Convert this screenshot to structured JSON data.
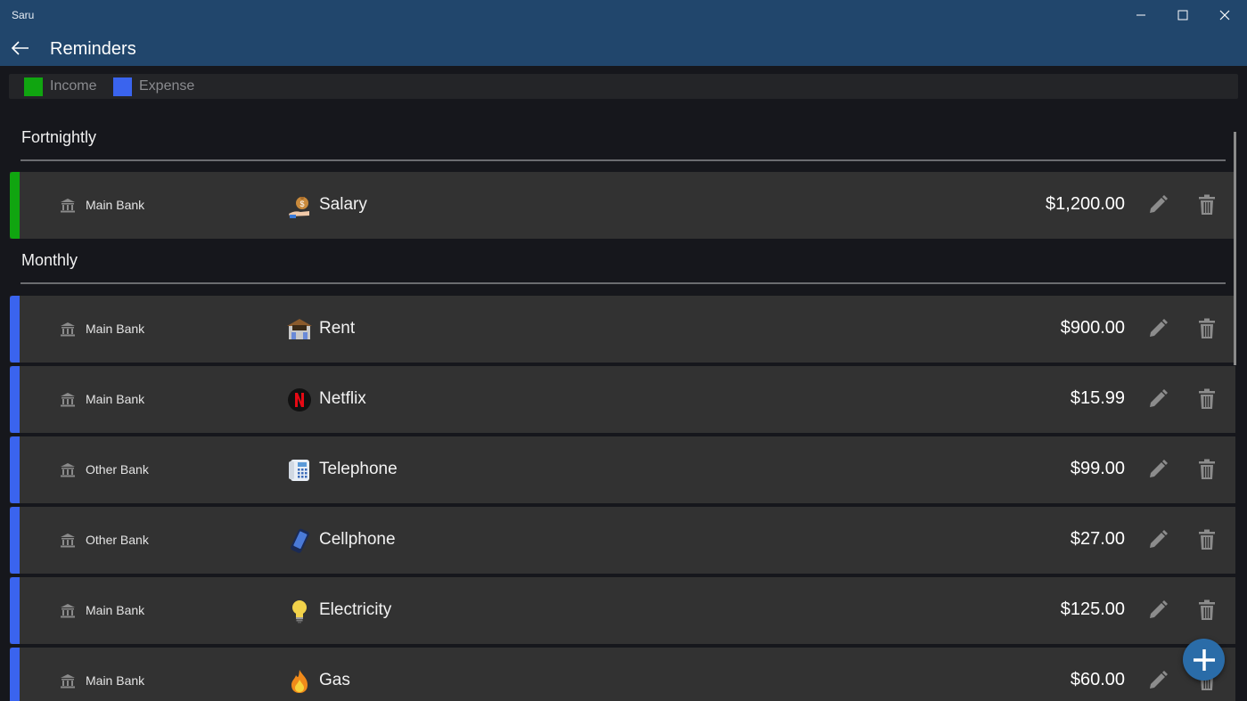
{
  "window": {
    "app_name": "Saru"
  },
  "header": {
    "title": "Reminders"
  },
  "legend": [
    {
      "label": "Income",
      "color": "#10a510"
    },
    {
      "label": "Expense",
      "color": "#3a64ee"
    }
  ],
  "groups": [
    {
      "title": "Fortnightly",
      "reminders": [
        {
          "type": "income",
          "bank": "Main Bank",
          "category": "Salary",
          "icon": "money-bag-icon",
          "amount": "$1,200.00"
        }
      ]
    },
    {
      "title": "Monthly",
      "reminders": [
        {
          "type": "expense",
          "bank": "Main Bank",
          "category": "Rent",
          "icon": "house-icon",
          "amount": "$900.00"
        },
        {
          "type": "expense",
          "bank": "Main Bank",
          "category": "Netflix",
          "icon": "netflix-icon",
          "amount": "$15.99"
        },
        {
          "type": "expense",
          "bank": "Other Bank",
          "category": "Telephone",
          "icon": "telephone-icon",
          "amount": "$99.00"
        },
        {
          "type": "expense",
          "bank": "Other Bank",
          "category": "Cellphone",
          "icon": "cellphone-icon",
          "amount": "$27.00"
        },
        {
          "type": "expense",
          "bank": "Main Bank",
          "category": "Electricity",
          "icon": "lightbulb-icon",
          "amount": "$125.00"
        },
        {
          "type": "expense",
          "bank": "Main Bank",
          "category": "Gas",
          "icon": "flame-icon",
          "amount": "$60.00"
        }
      ]
    }
  ],
  "colors": {
    "titlebar": "#21466c",
    "background": "#16171c",
    "row": "#323232",
    "fab": "#2a6ca8"
  },
  "icons": {
    "back": "back-arrow-icon",
    "edit": "pencil-icon",
    "delete": "trash-icon",
    "bank": "bank-icon",
    "add": "plus-icon"
  }
}
